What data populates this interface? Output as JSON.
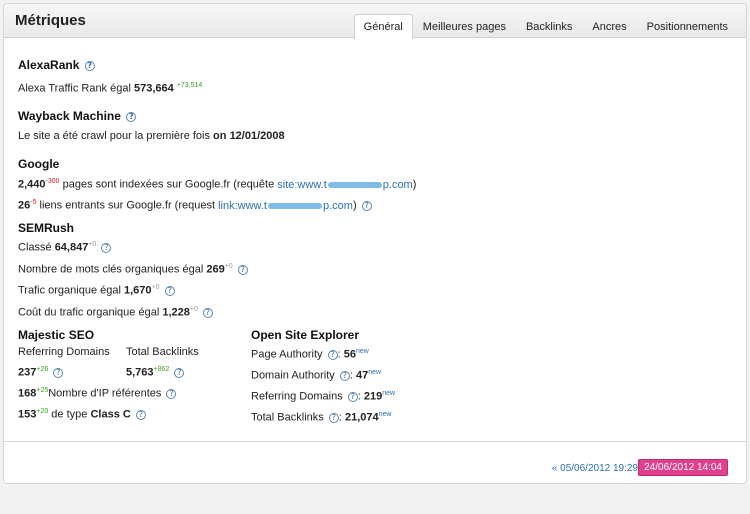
{
  "header": {
    "title": "Métriques",
    "tabs": [
      {
        "label": "Général",
        "active": true
      },
      {
        "label": "Meilleures pages"
      },
      {
        "label": "Backlinks"
      },
      {
        "label": "Ancres"
      },
      {
        "label": "Positionnements"
      }
    ]
  },
  "alexa": {
    "heading": "AlexaRank",
    "text": "Alexa Traffic Rank égal",
    "value": "573,664",
    "delta": "+73,514"
  },
  "wayback": {
    "heading": "Wayback Machine",
    "text": "Le site a été crawl pour la première fois",
    "on": "on",
    "date": "12/01/2008"
  },
  "google": {
    "heading": "Google",
    "pages_value": "2,440",
    "pages_delta": "-300",
    "pages_text": "pages sont indexées sur Google.fr (requête",
    "pages_link_start": "site:www.t",
    "pages_link_end": "p.com",
    "pages_close": ")",
    "links_value": "26",
    "links_delta": "-5",
    "links_text": "liens entrants sur Google.fr (request",
    "links_link_start": "link:www.t",
    "links_link_end": "p.com",
    "links_close": ")"
  },
  "semrush": {
    "heading": "SEMRush",
    "classe_label": "Classé",
    "classe_value": "64,847",
    "classe_delta": "+0",
    "keywords_label": "Nombre de mots clés organiques égal",
    "keywords_value": "269",
    "keywords_delta": "+0",
    "traffic_label": "Trafic organique égal",
    "traffic_value": "1,670",
    "traffic_delta": "+0",
    "cost_label": "Coût du trafic organique égal",
    "cost_value": "1,228",
    "cost_delta": "+0"
  },
  "majestic": {
    "heading": "Majestic SEO",
    "col1": "Referring Domains",
    "col2": "Total Backlinks",
    "rd_value": "237",
    "rd_delta": "+26",
    "tb_value": "5,763",
    "tb_delta": "+862",
    "ip_value": "168",
    "ip_delta": "+25",
    "ip_text": "Nombre d'IP référentes",
    "classc_value": "153",
    "classc_delta": "+20",
    "classc_text": "de type",
    "classc_bold": "Class C"
  },
  "ose": {
    "heading": "Open Site Explorer",
    "pa_label": "Page Authority",
    "pa_value": "56",
    "da_label": "Domain Authority",
    "da_value": "47",
    "rd_label": "Referring Domains",
    "rd_value": "219",
    "tb_label": "Total Backlinks",
    "tb_value": "21,074",
    "new_label": "new"
  },
  "footer": {
    "prev": "« 05/06/2012 19:29",
    "current": "24/06/2012 14:04"
  },
  "help_glyph": "?",
  "colors": {
    "link": "#2a6fb3",
    "badge": "#e0408e",
    "up": "#3a9a20",
    "down": "#c82020"
  }
}
